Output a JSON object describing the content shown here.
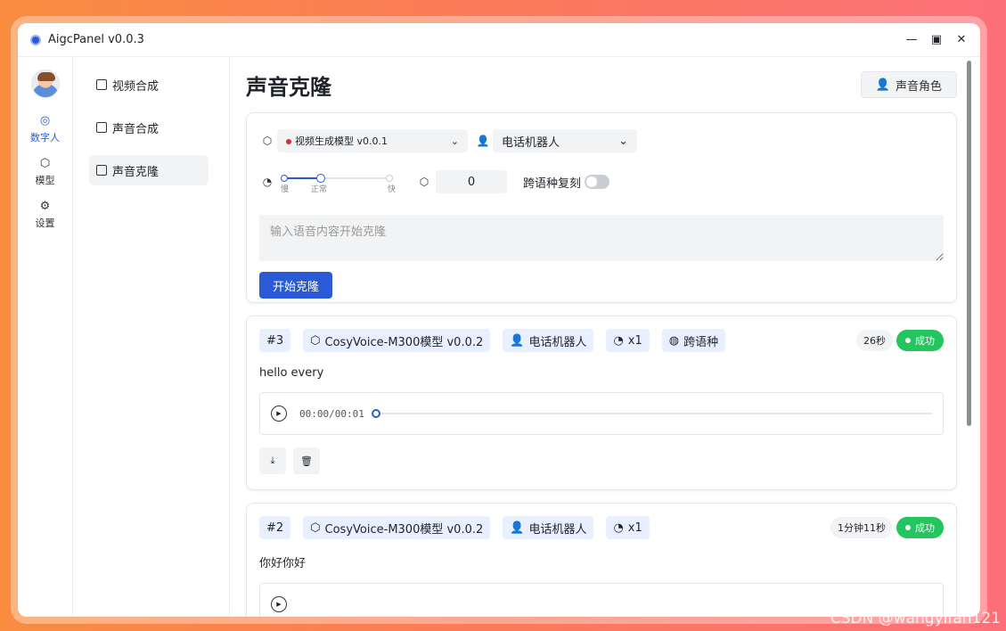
{
  "window": {
    "title": "AigcPanel v0.0.3",
    "controls": [
      "—",
      "▣",
      "✕"
    ]
  },
  "rail": {
    "items": [
      {
        "label": "数字人",
        "icon": "ai-icon",
        "active": true
      },
      {
        "label": "模型",
        "icon": "cube-icon",
        "active": false
      },
      {
        "label": "设置",
        "icon": "gear-icon",
        "active": false
      }
    ]
  },
  "subnav": {
    "items": [
      {
        "label": "视频合成",
        "active": false
      },
      {
        "label": "声音合成",
        "active": false
      },
      {
        "label": "声音克隆",
        "active": true
      }
    ]
  },
  "page": {
    "title": "声音克隆",
    "role_button": "声音角色"
  },
  "form": {
    "model": "视频生成模型 v0.0.1",
    "voice": "电话机器人",
    "speed_labels": [
      "慢",
      "正常",
      "快"
    ],
    "speed_level": "正常",
    "seed": "0",
    "cross_lingual_label": "跨语种复刻",
    "cross_lingual_on": false,
    "text_placeholder": "输入语音内容开始克隆",
    "submit": "开始克隆"
  },
  "records": [
    {
      "id": "#3",
      "model": "CosyVoice-M300模型 v0.0.2",
      "voice": "电话机器人",
      "speed": "x1",
      "cross": "跨语种",
      "duration": "26秒",
      "status": "成功",
      "text": "hello every",
      "time": "00:00/00:01"
    },
    {
      "id": "#2",
      "model": "CosyVoice-M300模型 v0.0.2",
      "voice": "电话机器人",
      "speed": "x1",
      "duration": "1分钟11秒",
      "status": "成功",
      "text": "你好你好"
    }
  ],
  "watermark": "CSDN @wangyifan121",
  "colors": {
    "accent": "#2b5ad6",
    "success": "#22c55e",
    "tag_bg": "#e8efff"
  }
}
